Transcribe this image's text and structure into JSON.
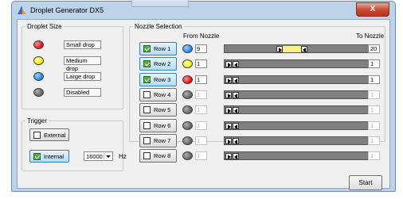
{
  "window": {
    "title": "Droplet Generator DX5",
    "close_label": "X"
  },
  "droplet_size": {
    "legend": "Droplet Size",
    "items": [
      {
        "label": "Small drop",
        "color": "#2a8de8"
      },
      {
        "label": "Medium drop",
        "color": "#f2f21a"
      },
      {
        "label": "Large drop",
        "color": "#2a8de8"
      },
      {
        "label": "Disabled",
        "color": "#6b6b6b"
      }
    ]
  },
  "trigger": {
    "legend": "Trigger",
    "external_label": "External",
    "internal_label": "Internal",
    "frequency_value": "16000",
    "unit": "Hz"
  },
  "nozzle_selection": {
    "legend": "Nozzle Selection",
    "from_header": "From Nozzle",
    "to_header": "To Nozzle",
    "rows": [
      {
        "label": "Row 1",
        "enabled": true,
        "from": "9",
        "to": "20",
        "range": [
          9,
          20
        ],
        "color": "#2a8de8"
      },
      {
        "label": "Row 2",
        "enabled": true,
        "from": "1",
        "to": "1",
        "range": [
          1,
          1
        ],
        "color": "#f2f21a"
      },
      {
        "label": "Row 3",
        "enabled": true,
        "from": "1",
        "to": "1",
        "range": [
          1,
          1
        ],
        "color": "#e51a1a"
      },
      {
        "label": "Row 4",
        "enabled": false,
        "from": "1",
        "to": "1",
        "range": [
          1,
          1
        ],
        "color": "#6b6b6b"
      },
      {
        "label": "Row 5",
        "enabled": false,
        "from": "1",
        "to": "1",
        "range": [
          1,
          1
        ],
        "color": "#6b6b6b"
      },
      {
        "label": "Row 6",
        "enabled": false,
        "from": "1",
        "to": "1",
        "range": [
          1,
          1
        ],
        "color": "#6b6b6b"
      },
      {
        "label": "Row 7",
        "enabled": false,
        "from": "1",
        "to": "1",
        "range": [
          1,
          1
        ],
        "color": "#6b6b6b"
      },
      {
        "label": "Row 8",
        "enabled": false,
        "from": "1",
        "to": "1",
        "range": [
          1,
          1
        ],
        "color": "#6b6b6b"
      }
    ]
  },
  "start_label": "Start"
}
